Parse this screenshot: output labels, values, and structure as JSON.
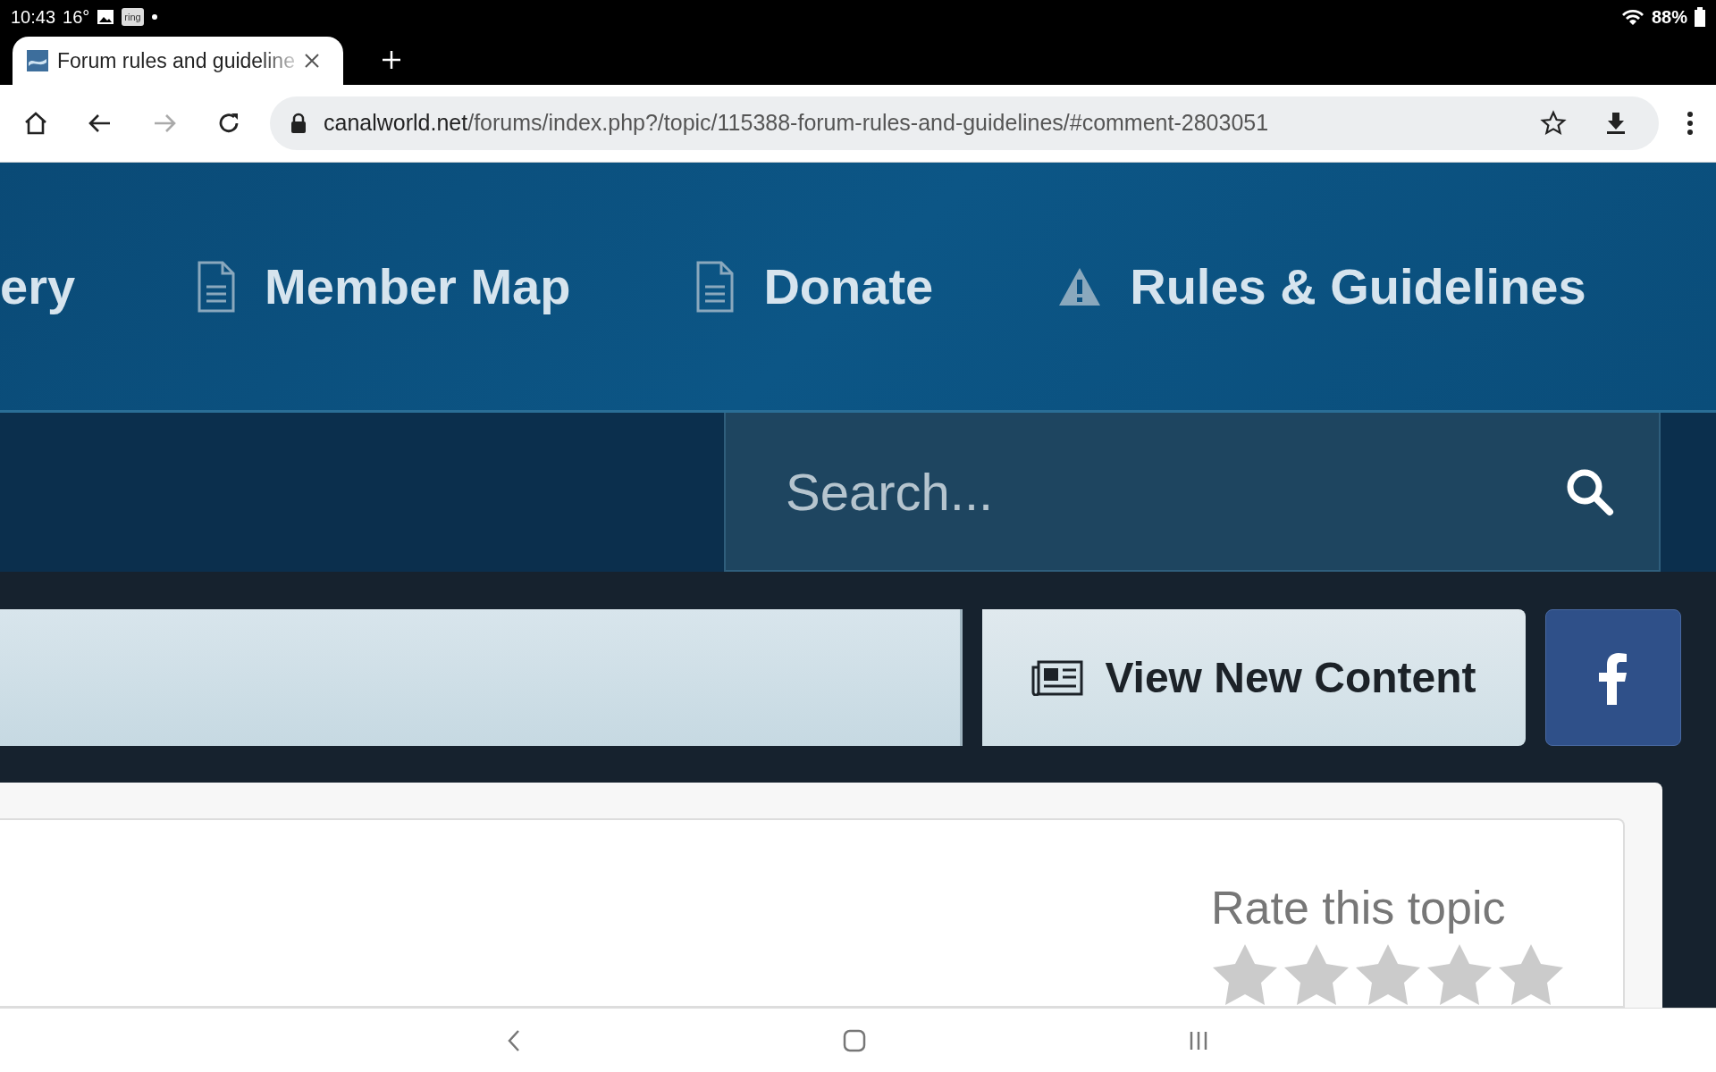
{
  "status_bar": {
    "time": "10:43",
    "temperature": "16°",
    "app_badge": "ring",
    "battery": "88%"
  },
  "browser": {
    "tab": {
      "title": "Forum rules and guideline",
      "selected": true
    },
    "forward": {
      "disabled": true
    },
    "url_domain": "canalworld.net",
    "url_path": "/forums/index.php?/topic/115388-forum-rules-and-guidelines/#comment-2803051"
  },
  "nav": {
    "items": [
      {
        "label": "ery",
        "kind": "plain"
      },
      {
        "label": "Member Map",
        "kind": "page"
      },
      {
        "label": "Donate",
        "kind": "page"
      },
      {
        "label": "Rules & Guidelines",
        "kind": "warning"
      }
    ]
  },
  "search": {
    "placeholder": "Search..."
  },
  "actions": {
    "view_new_content": "View New Content"
  },
  "rating": {
    "title": "Rate this topic",
    "stars": 0
  }
}
